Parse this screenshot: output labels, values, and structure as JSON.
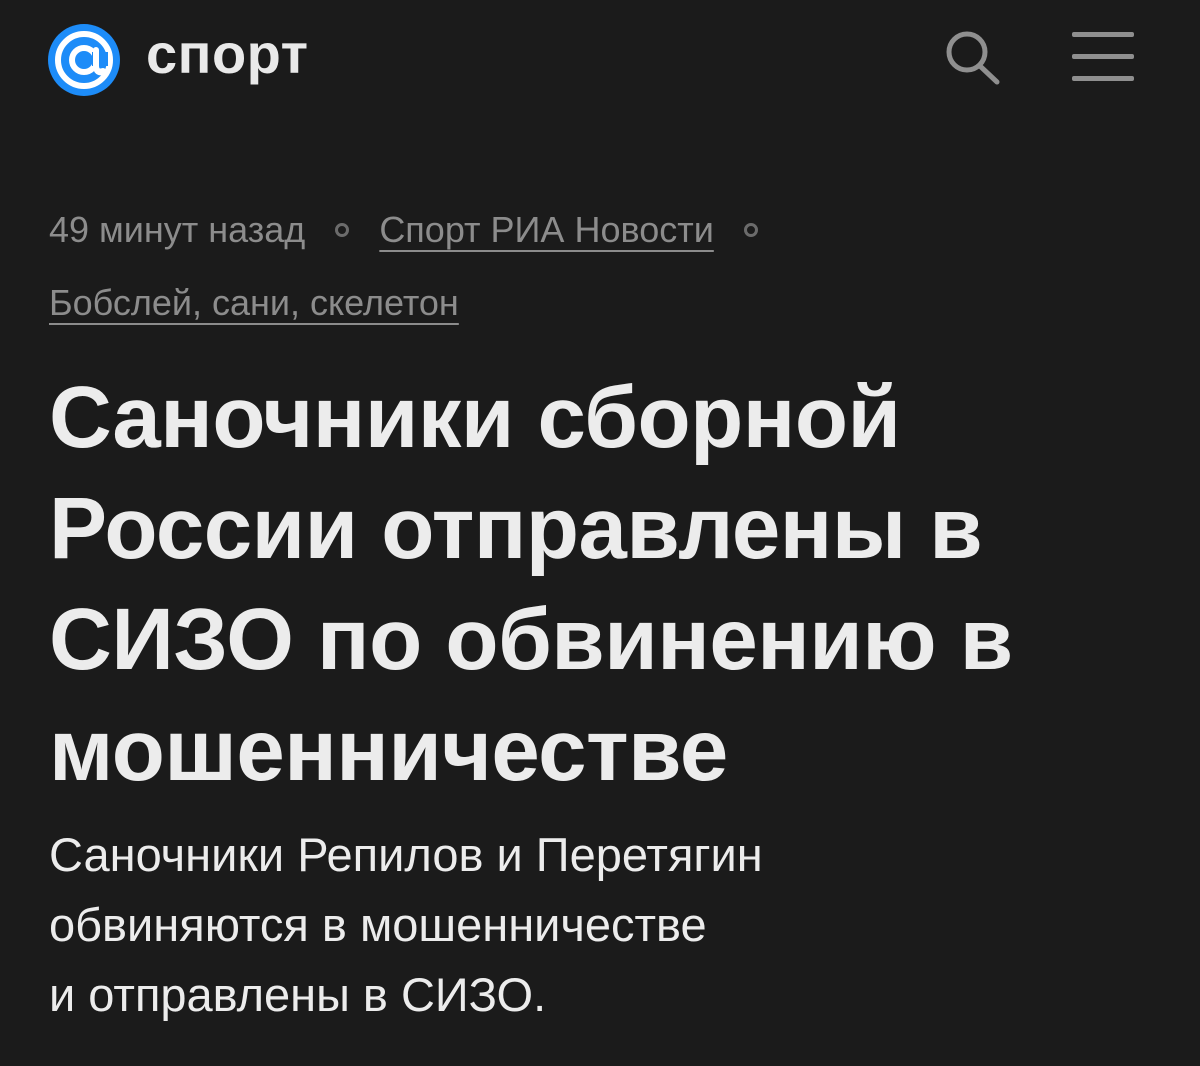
{
  "header": {
    "logo_text": "спорт",
    "search_icon": "search-icon",
    "menu_icon": "hamburger-menu-icon",
    "accent_color": "#1d8cf8"
  },
  "meta": {
    "time_ago": "49 минут назад",
    "source": "Спорт РИА Новости",
    "rubric": "Бобслей, сани, скелетон"
  },
  "article": {
    "headline": "Саночники сборной России отправлены в СИЗО по обвинению в мошенничестве",
    "lead_lines": [
      "Саночники Репилов и Перетягин",
      "обвиняются в мошенничестве",
      "и отправлены в СИЗО."
    ]
  }
}
